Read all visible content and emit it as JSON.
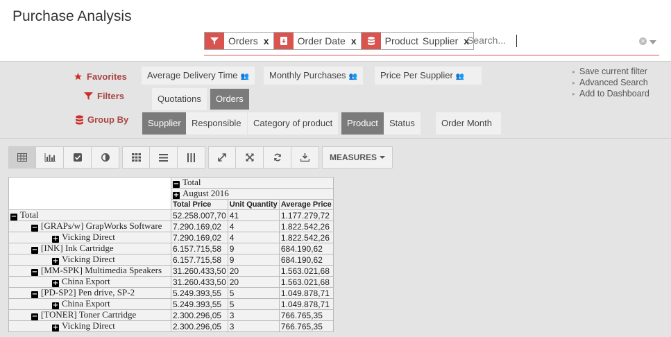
{
  "title": "Purchase Analysis",
  "facets": [
    {
      "icon": "filter-icon",
      "values": [
        "Orders"
      ]
    },
    {
      "icon": "group-by-date-icon",
      "values": [
        "Order Date"
      ]
    },
    {
      "icon": "database-icon",
      "values": [
        "Product",
        "Supplier"
      ]
    }
  ],
  "facet_remove": "x",
  "search": {
    "placeholder": "Search..."
  },
  "favorites": {
    "label": "Favorites",
    "items": [
      "Average Delivery Time",
      "Monthly Purchases",
      "Price Per Supplier"
    ]
  },
  "filters": {
    "label": "Filters",
    "items": [
      {
        "label": "Quotations",
        "active": false
      },
      {
        "label": "Orders",
        "active": true
      }
    ]
  },
  "groupby": {
    "label": "Group By",
    "items": [
      {
        "label": "Supplier",
        "active": true
      },
      {
        "label": "Responsible",
        "active": false
      },
      {
        "label": "Category of product",
        "active": false
      },
      {
        "label": "Product",
        "active": true
      },
      {
        "label": "Status",
        "active": false
      },
      {
        "label": "Order Month",
        "active": false
      }
    ]
  },
  "right_links": [
    "Save current filter",
    "Advanced Search",
    "Add to Dashboard"
  ],
  "toolbar": {
    "view_buttons": [
      "pivot-table-icon",
      "bar-chart-icon",
      "line-chart-icon",
      "pie-chart-icon"
    ],
    "layout_buttons": [
      "heatmap-grid-icon",
      "row-layout-icon",
      "column-layout-icon"
    ],
    "action_buttons": [
      "expand-icon",
      "collapse-all-icon",
      "swap-axis-icon",
      "download-icon"
    ],
    "measures_label": "MEASURES"
  },
  "pivot": {
    "col_total": "Total",
    "col_month": "August 2016",
    "measures": [
      "Total Price",
      "Unit Quantity",
      "Average Price"
    ],
    "rows": [
      {
        "label": "Total",
        "level": 0,
        "icon": "minus",
        "values": [
          "52.258.007,70",
          "41",
          "1.177.279,72"
        ]
      },
      {
        "label": "[GRAPs/w] GrapWorks Software",
        "level": 1,
        "icon": "minus",
        "values": [
          "7.290.169,02",
          "4",
          "1.822.542,26"
        ]
      },
      {
        "label": "Vicking Direct",
        "level": 2,
        "icon": "plus",
        "values": [
          "7.290.169,02",
          "4",
          "1.822.542,26"
        ]
      },
      {
        "label": "[INK] Ink Cartridge",
        "level": 1,
        "icon": "minus",
        "values": [
          "6.157.715,58",
          "9",
          "684.190,62"
        ]
      },
      {
        "label": "Vicking Direct",
        "level": 2,
        "icon": "plus",
        "values": [
          "6.157.715,58",
          "9",
          "684.190,62"
        ]
      },
      {
        "label": "[MM-SPK] Multimedia Speakers",
        "level": 1,
        "icon": "minus",
        "values": [
          "31.260.433,50",
          "20",
          "1.563.021,68"
        ]
      },
      {
        "label": "China Export",
        "level": 2,
        "icon": "plus",
        "values": [
          "31.260.433,50",
          "20",
          "1.563.021,68"
        ]
      },
      {
        "label": "[PD-SP2] Pen drive, SP-2",
        "level": 1,
        "icon": "minus",
        "values": [
          "5.249.393,55",
          "5",
          "1.049.878,71"
        ]
      },
      {
        "label": "China Export",
        "level": 2,
        "icon": "plus",
        "values": [
          "5.249.393,55",
          "5",
          "1.049.878,71"
        ]
      },
      {
        "label": "[TONER] Toner Cartridge",
        "level": 1,
        "icon": "minus",
        "values": [
          "2.300.296,05",
          "3",
          "766.765,35"
        ]
      },
      {
        "label": "Vicking Direct",
        "level": 2,
        "icon": "plus",
        "values": [
          "2.300.296,05",
          "3",
          "766.765,35"
        ]
      }
    ]
  }
}
